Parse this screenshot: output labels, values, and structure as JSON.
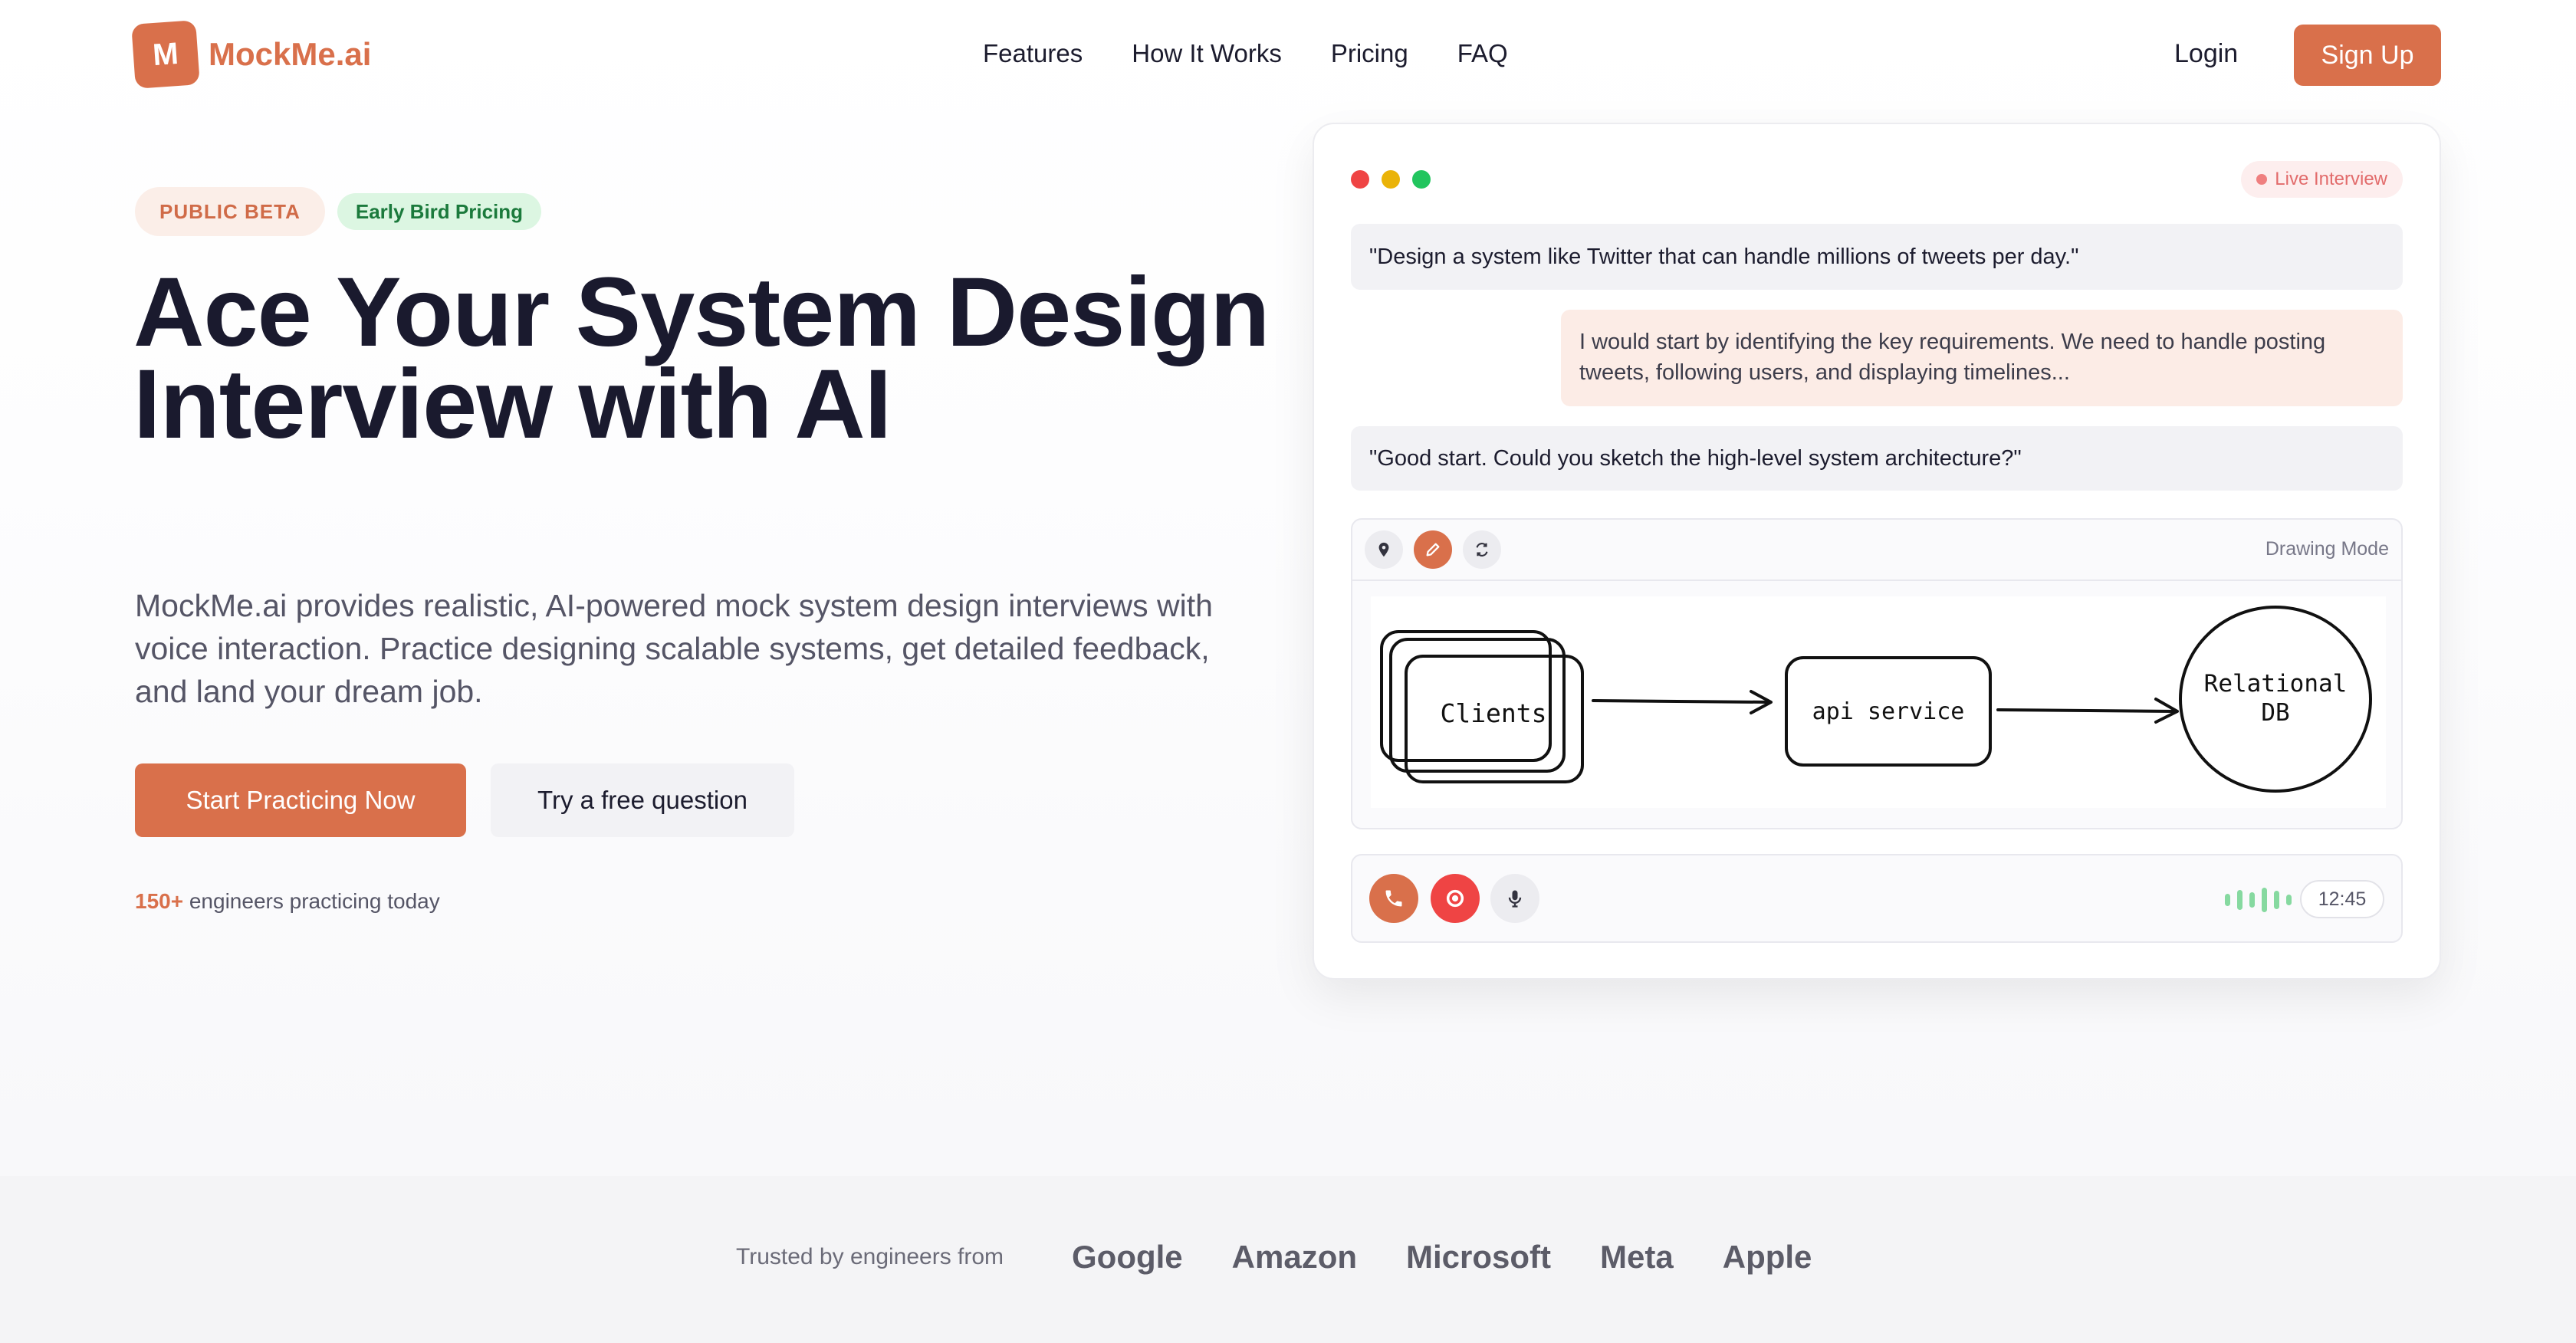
{
  "brand": {
    "logo_letter": "M",
    "name": "MockMe.ai",
    "accent": "#d9704b"
  },
  "nav": {
    "links": [
      "Features",
      "How It Works",
      "Pricing",
      "FAQ"
    ],
    "login": "Login",
    "signup": "Sign Up"
  },
  "hero": {
    "badge_beta": "PUBLIC BETA",
    "badge_early": "Early Bird Pricing",
    "title": "Ace Your System Design Interview with AI",
    "description": "MockMe.ai provides realistic, AI-powered mock system design interviews with voice interaction. Practice designing scalable systems, get detailed feedback, and land your dream job.",
    "cta_primary": "Start Practicing Now",
    "cta_secondary": "Try a free question",
    "social_count": "150+",
    "social_text": "engineers practicing today"
  },
  "mockup": {
    "live_label": "Live Interview",
    "messages": [
      "\"Design a system like Twitter that can handle millions of tweets per day.\"",
      "I would start by identifying the key requirements. We need to handle posting tweets, following users, and displaying timelines...",
      "\"Good start. Could you sketch the high-level system architecture?\""
    ],
    "drawing_mode": "Drawing Mode",
    "diagram": {
      "node_1": "Clients",
      "node_2": "api service",
      "node_3_line1": "Relational",
      "node_3_line2": "DB"
    },
    "timer": "12:45",
    "icons": [
      "pin-icon",
      "pencil-icon",
      "refresh-icon",
      "phone-icon",
      "stop-record-icon",
      "microphone-icon"
    ]
  },
  "trusted": {
    "label": "Trusted by engineers from",
    "companies": [
      "Google",
      "Amazon",
      "Microsoft",
      "Meta",
      "Apple"
    ]
  }
}
